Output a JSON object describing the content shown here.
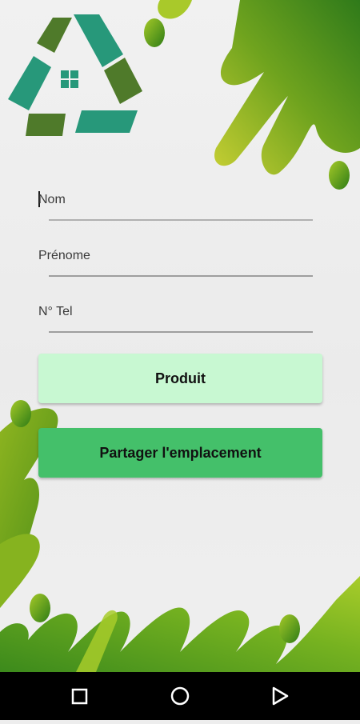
{
  "form": {
    "nom_placeholder": "Nom",
    "prenom_placeholder": "Prénome",
    "tel_placeholder": "N° Tel"
  },
  "buttons": {
    "produit_label": "Produit",
    "partager_label": "Partager l'emplacement"
  },
  "navbar": {
    "recents_icon": "square-icon",
    "home_icon": "circle-icon",
    "back_icon": "triangle-back-icon"
  },
  "colors": {
    "produit_button": "#c8f8d2",
    "partager_button": "#44c06a",
    "decor_green_dark": "#3f8a1a",
    "decor_green_light": "#c9cf35",
    "logo_teal": "#27987a",
    "logo_green": "#4f7a2a"
  }
}
